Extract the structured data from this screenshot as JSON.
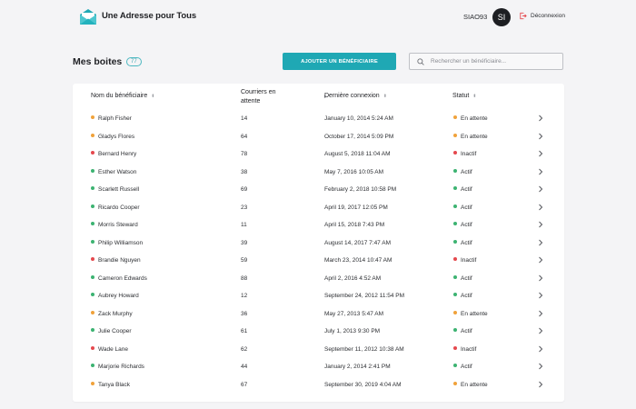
{
  "header": {
    "app_title": "Une Adresse pour Tous",
    "user_code": "SIAO93",
    "avatar_initials": "SI",
    "logout_label": "Déconnexion"
  },
  "page": {
    "title": "Mes boites",
    "count": "77",
    "add_button_label": "AJOUTER UN BÉNÉFICIAIRE",
    "search_placeholder": "Rechercher un bénéficiaire..."
  },
  "colors": {
    "accent": "#1fa8b4",
    "status_en_attente": "#f0a23a",
    "status_actif": "#3cb371",
    "status_inactif": "#e5484d"
  },
  "table": {
    "columns": {
      "name": "Nom du bénéficiaire",
      "mail_line1": "Courriers en",
      "mail_line2": "attente",
      "last_login": "Dernière connexion",
      "status": "Statut"
    },
    "rows": [
      {
        "name": "Ralph Fisher",
        "mail": "14",
        "last_login": "January 10, 2014 5:24 AM",
        "status": "En attente",
        "status_key": "en_attente"
      },
      {
        "name": "Gladys Flores",
        "mail": "64",
        "last_login": "October 17, 2014 5:09 PM",
        "status": "En attente",
        "status_key": "en_attente"
      },
      {
        "name": "Bernard Henry",
        "mail": "78",
        "last_login": "August 5, 2018 11:04 AM",
        "status": "Inactif",
        "status_key": "inactif"
      },
      {
        "name": "Esther Watson",
        "mail": "38",
        "last_login": "May 7, 2016 10:05 AM",
        "status": "Actif",
        "status_key": "actif"
      },
      {
        "name": "Scarlett Russell",
        "mail": "69",
        "last_login": "February 2, 2018 10:58 PM",
        "status": "Actif",
        "status_key": "actif"
      },
      {
        "name": "Ricardo Cooper",
        "mail": "23",
        "last_login": "April 19, 2017 12:05 PM",
        "status": "Actif",
        "status_key": "actif"
      },
      {
        "name": "Morris Steward",
        "mail": "11",
        "last_login": "April 15, 2018 7:43 PM",
        "status": "Actif",
        "status_key": "actif"
      },
      {
        "name": "Philip Williamson",
        "mail": "39",
        "last_login": "August 14, 2017 7:47 AM",
        "status": "Actif",
        "status_key": "actif"
      },
      {
        "name": "Brandie Nguyen",
        "mail": "59",
        "last_login": "March 23, 2014 10:47 AM",
        "status": "Inactif",
        "status_key": "inactif"
      },
      {
        "name": "Cameron Edwards",
        "mail": "88",
        "last_login": "April 2, 2016 4:52 AM",
        "status": "Actif",
        "status_key": "actif"
      },
      {
        "name": "Aubrey Howard",
        "mail": "12",
        "last_login": "September 24, 2012 11:54 PM",
        "status": "Actif",
        "status_key": "actif"
      },
      {
        "name": "Zack Murphy",
        "mail": "36",
        "last_login": "May 27, 2013 5:47 AM",
        "status": "En attente",
        "status_key": "en_attente"
      },
      {
        "name": "Julie Cooper",
        "mail": "61",
        "last_login": "July 1, 2013 9:30 PM",
        "status": "Actif",
        "status_key": "actif"
      },
      {
        "name": "Wade Lane",
        "mail": "62",
        "last_login": "September 11, 2012 10:38 AM",
        "status": "Inactif",
        "status_key": "inactif"
      },
      {
        "name": "Marjorie Richards",
        "mail": "44",
        "last_login": "January 2, 2014 2:41 PM",
        "status": "Actif",
        "status_key": "actif"
      },
      {
        "name": "Tanya Black",
        "mail": "67",
        "last_login": "September 30, 2019 4:04 AM",
        "status": "En attente",
        "status_key": "en_attente"
      }
    ]
  }
}
